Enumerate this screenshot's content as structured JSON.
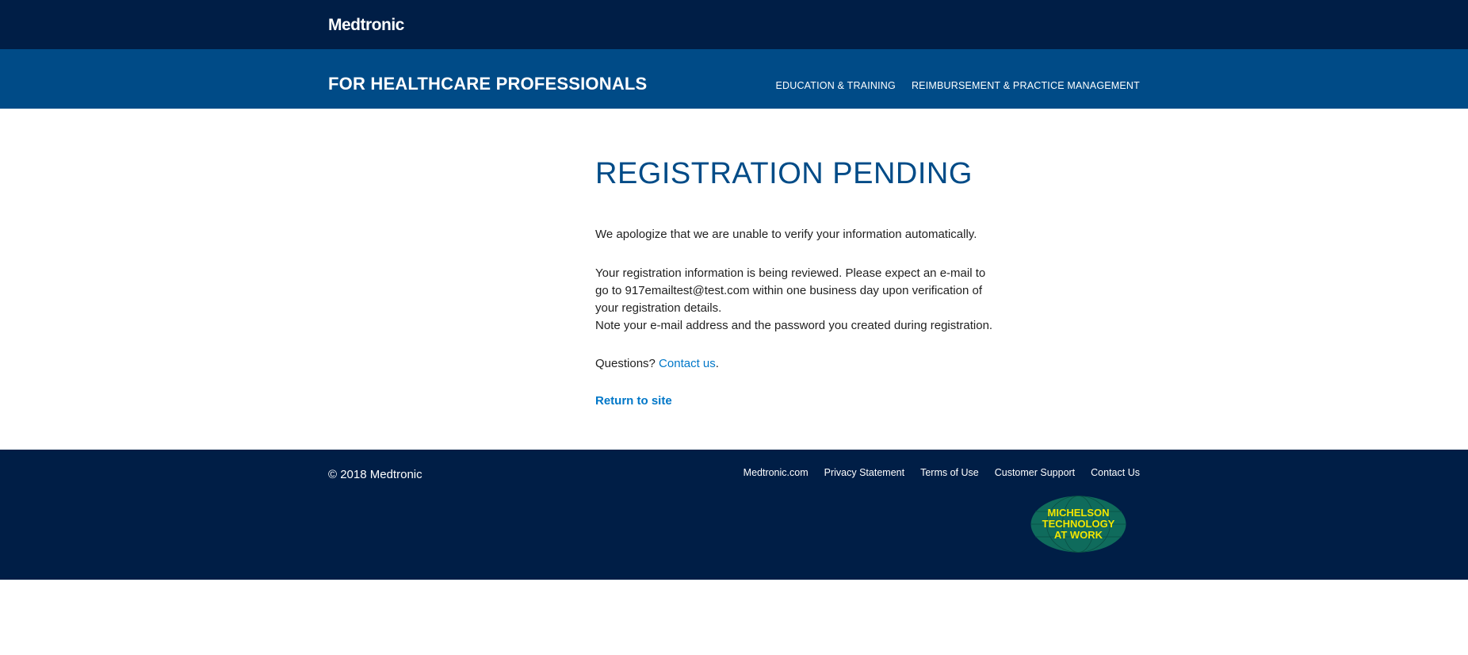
{
  "header": {
    "logo_text": "Medtronic",
    "section_title": "FOR HEALTHCARE PROFESSIONALS",
    "nav": [
      {
        "label": "EDUCATION & TRAINING"
      },
      {
        "label": "REIMBURSEMENT & PRACTICE MANAGEMENT"
      }
    ]
  },
  "main": {
    "title": "REGISTRATION PENDING",
    "apology": "We apologize that we are unable to verify your information automatically.",
    "review_line1": "Your registration information is being reviewed. Please expect an e-mail to go to 917emailtest@test.com within one business day upon verification of your registration details.",
    "review_line2": "Note your e-mail address and the password you created during registration.",
    "questions_prefix": "Questions? ",
    "contact_link": "Contact us",
    "questions_suffix": ".",
    "return_link": "Return to site"
  },
  "footer": {
    "copyright": "© 2018 Medtronic",
    "links": [
      {
        "label": "Medtronic.com"
      },
      {
        "label": "Privacy Statement"
      },
      {
        "label": "Terms of Use"
      },
      {
        "label": "Customer Support"
      },
      {
        "label": "Contact Us"
      }
    ],
    "badge": {
      "line1": "MICHELSON",
      "line2": "TECHNOLOGY",
      "line3": "AT WORK",
      "bg_color": "#0f6b5c",
      "text_color": "#f2e600"
    }
  },
  "colors": {
    "top_bar": "#001e46",
    "sub_bar": "#004b87",
    "accent_link": "#0077c8",
    "title": "#004b87"
  }
}
